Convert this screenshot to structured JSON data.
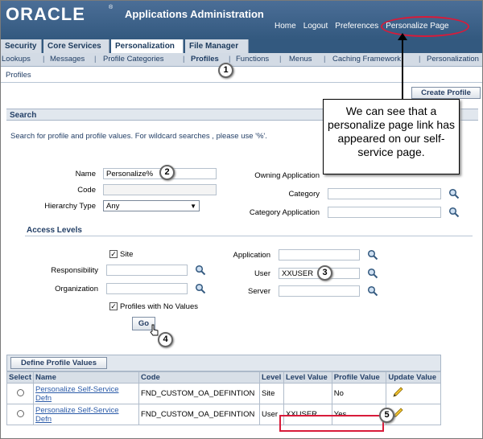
{
  "header": {
    "logo": "ORACLE",
    "logo_mark": "®",
    "app_title": "Applications Administration",
    "global_links": [
      "Home",
      "Logout",
      "Preferences",
      "Personalize Page"
    ]
  },
  "tabs": [
    "Security",
    "Core Services",
    "Personalization",
    "File Manager"
  ],
  "subtabs": [
    "Lookups",
    "Messages",
    "Profile Categories",
    "Profiles",
    "Functions",
    "Menus",
    "Caching Framework",
    "Personalization"
  ],
  "breadcrumb": "Profiles",
  "create_profile_label": "Create Profile",
  "search": {
    "title": "Search",
    "hint": "Search for profile and profile values. For wildcard searches , please use '%'.",
    "name_label": "Name",
    "name_value": "Personalize%",
    "code_label": "Code",
    "code_placeholder": "",
    "hierarchy_label": "Hierarchy Type",
    "hierarchy_value": "Any",
    "owning_app_label": "Owning Application",
    "category_label": "Category",
    "category_app_label": "Category Application"
  },
  "access": {
    "title": "Access Levels",
    "site_label": "Site",
    "site_checked": "✓",
    "responsibility_label": "Responsibility",
    "organization_label": "Organization",
    "no_values_label": "Profiles with No Values",
    "no_values_checked": "✓",
    "application_label": "Application",
    "user_label": "User",
    "user_value": "XXUSER",
    "server_label": "Server",
    "go_label": "Go"
  },
  "define_label": "Define Profile Values",
  "table": {
    "headers": [
      "Select",
      "Name",
      "Code",
      "Level",
      "Level Value",
      "Profile Value",
      "Update Value"
    ],
    "rows": [
      {
        "name": "Personalize Self-Service Defn",
        "code": "FND_CUSTOM_OA_DEFINTION",
        "level": "Site",
        "level_value": "",
        "profile_value": "No"
      },
      {
        "name": "Personalize Self-Service Defn",
        "code": "FND_CUSTOM_OA_DEFINTION",
        "level": "User",
        "level_value": "XXUSER",
        "profile_value": "Yes"
      }
    ]
  },
  "callout": "We can see that a personalize page link has appeared on our self-service page.",
  "badges": [
    "1",
    "2",
    "3",
    "4",
    "5"
  ],
  "colors": {
    "header": "#33597f",
    "highlight": "#d81b3a"
  }
}
